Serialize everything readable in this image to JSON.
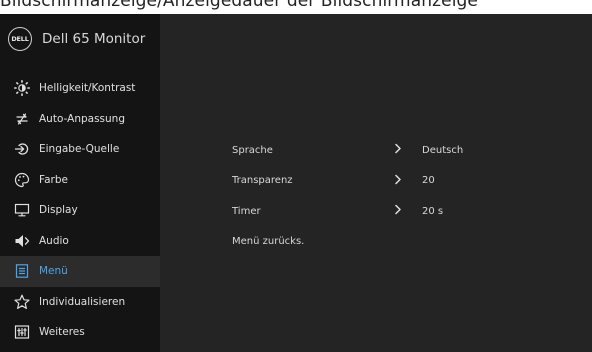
{
  "caption": "Bildschirmanzeige/Anzeigedauer der Bildschirmanzeige",
  "header": {
    "logo_text": "DELL",
    "title": "Dell 65 Monitor"
  },
  "menu": {
    "items": [
      {
        "label": "Helligkeit/Kontrast",
        "icon": "brightness-icon"
      },
      {
        "label": "Auto-Anpassung",
        "icon": "auto-adjust-icon"
      },
      {
        "label": "Eingabe-Quelle",
        "icon": "input-source-icon"
      },
      {
        "label": "Farbe",
        "icon": "color-palette-icon"
      },
      {
        "label": "Display",
        "icon": "display-icon"
      },
      {
        "label": "Audio",
        "icon": "audio-icon"
      },
      {
        "label": "Menü",
        "icon": "menu-icon",
        "active": true
      },
      {
        "label": "Individualisieren",
        "icon": "star-icon"
      },
      {
        "label": "Weiteres",
        "icon": "others-icon"
      }
    ]
  },
  "settings": {
    "rows": [
      {
        "label": "Sprache",
        "value": "Deutsch"
      },
      {
        "label": "Transparenz",
        "value": "20"
      },
      {
        "label": "Timer",
        "value": "20 s"
      }
    ],
    "reset_label": "Menü zurücks."
  },
  "colors": {
    "accent": "#4fa3e8",
    "sidebar": "#141414",
    "panel": "#242424"
  }
}
